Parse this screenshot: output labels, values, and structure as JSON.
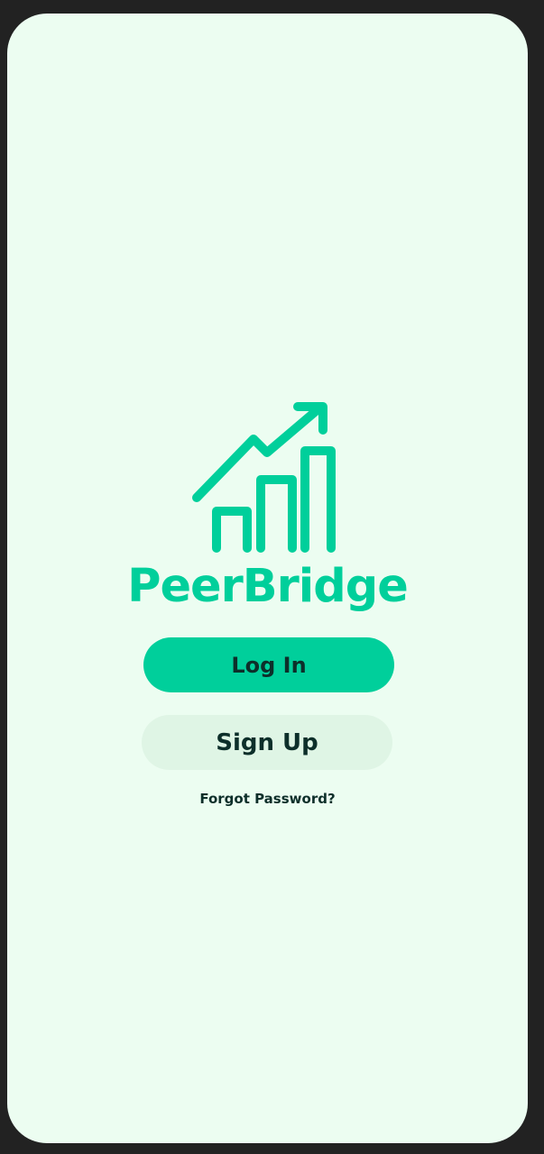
{
  "app": {
    "name": "PeerBridge",
    "logo_icon": "growth-chart-icon"
  },
  "actions": {
    "login_label": "Log In",
    "signup_label": "Sign Up",
    "forgot_password_label": "Forgot Password?"
  },
  "colors": {
    "background": "#ecfdf1",
    "brand": "#00cf9b",
    "login_button": "#00cf9b",
    "signup_button": "#dff5e5",
    "button_text": "#0d2f2a",
    "outer_frame": "#222222"
  }
}
